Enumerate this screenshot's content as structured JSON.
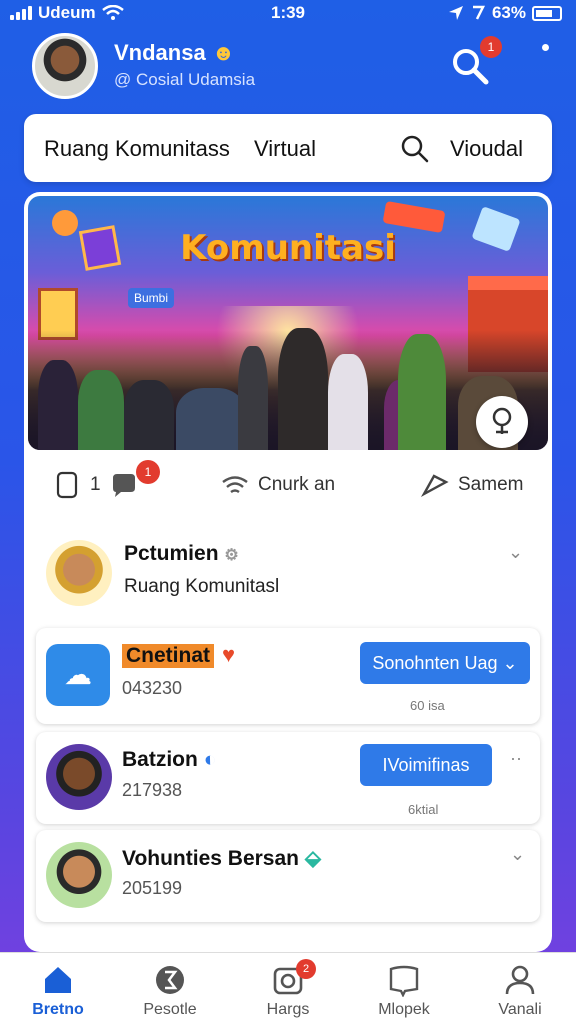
{
  "status_bar": {
    "carrier": "Udeum",
    "time": "1:39",
    "battery": "63%"
  },
  "header": {
    "user_name": "Vndansa",
    "user_subtitle": "Cosial Udamsia",
    "notification_count": "1"
  },
  "search": {
    "left_text": "Ruang Komunitass",
    "middle_text": "Virtual",
    "right_text": "Vioudal"
  },
  "hero": {
    "title": "Komunitasi",
    "sign_left": "Bumbi",
    "sign_right": ""
  },
  "actions": {
    "count": "1",
    "badge": "1",
    "share_label": "Cnurk an",
    "send_label": "Samem"
  },
  "feed": [
    {
      "name": "Pctumien",
      "subtitle": "Ruang Komunitasl"
    },
    {
      "name": "Cnetinat",
      "number": "043230",
      "button": "Sonohnten Uag",
      "tiny": "60 isa"
    },
    {
      "name": "Batzion",
      "number": "217938",
      "button": "IVoimifinas",
      "tiny": "6ktial"
    },
    {
      "name": "Vohunties Bersan",
      "number": "205199"
    }
  ],
  "bottom_nav": [
    {
      "label": "Bretno",
      "icon": "home-icon",
      "active": true
    },
    {
      "label": "Pesotle",
      "icon": "globe-icon"
    },
    {
      "label": "Hargs",
      "icon": "camera-icon",
      "badge": "2"
    },
    {
      "label": "Mlopek",
      "icon": "book-icon"
    },
    {
      "label": "Vanali",
      "icon": "profile-icon"
    }
  ],
  "colors": {
    "primary": "#2f7ae8",
    "badge": "#e23b2e",
    "background": "#2a55e8"
  }
}
